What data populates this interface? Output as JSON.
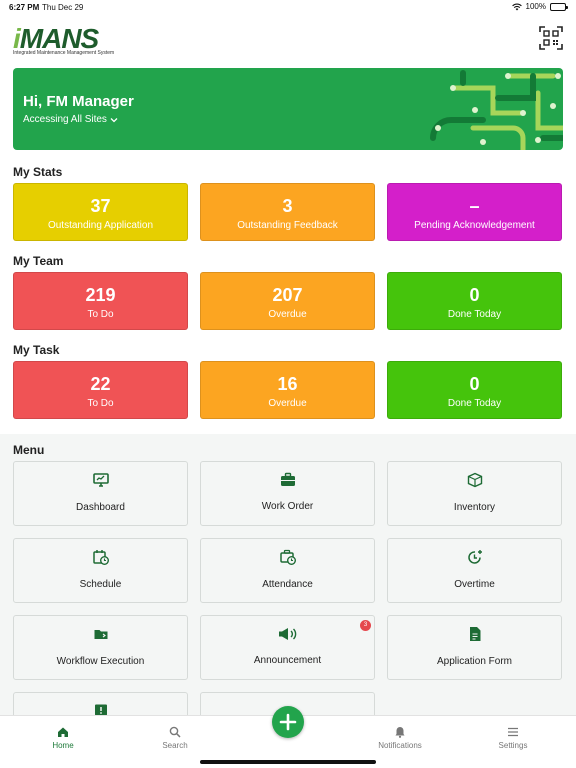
{
  "status_bar": {
    "time": "6:27 PM",
    "date": "Thu Dec 29",
    "battery": "100%"
  },
  "brand": {
    "logo_text": "MANS",
    "logo_i": "i",
    "tagline": "Integrated Maintenance Management System",
    "accent": "#22a44c"
  },
  "hero": {
    "greeting": "Hi, FM Manager",
    "site_selector": "Accessing All Sites"
  },
  "sections": {
    "stats": "My Stats",
    "team": "My Team",
    "task": "My Task",
    "menu": "Menu"
  },
  "stats": [
    {
      "value": "37",
      "label": "Outstanding Application",
      "color": "#e6cf00"
    },
    {
      "value": "3",
      "label": "Outstanding Feedback",
      "color": "#fca521"
    },
    {
      "value": "–",
      "label": "Pending Acknowledgement",
      "color": "#d41fca"
    }
  ],
  "team": [
    {
      "value": "219",
      "label": "To Do",
      "color": "#f05355"
    },
    {
      "value": "207",
      "label": "Overdue",
      "color": "#fca521"
    },
    {
      "value": "0",
      "label": "Done Today",
      "color": "#45c40c"
    }
  ],
  "task": [
    {
      "value": "22",
      "label": "To Do",
      "color": "#f05355"
    },
    {
      "value": "16",
      "label": "Overdue",
      "color": "#fca521"
    },
    {
      "value": "0",
      "label": "Done Today",
      "color": "#45c40c"
    }
  ],
  "menu": [
    {
      "label": "Dashboard",
      "icon": "dashboard-icon"
    },
    {
      "label": "Work Order",
      "icon": "briefcase-icon"
    },
    {
      "label": "Inventory",
      "icon": "box-icon"
    },
    {
      "label": "Schedule",
      "icon": "calendar-clock-icon"
    },
    {
      "label": "Attendance",
      "icon": "briefcase-clock-icon"
    },
    {
      "label": "Overtime",
      "icon": "clock-plus-icon"
    },
    {
      "label": "Workflow Execution",
      "icon": "folder-icon"
    },
    {
      "label": "Announcement",
      "icon": "megaphone-icon",
      "badge": "3"
    },
    {
      "label": "Application Form",
      "icon": "document-icon"
    }
  ],
  "tabs": [
    {
      "label": "Home",
      "icon": "home-icon"
    },
    {
      "label": "Search",
      "icon": "search-icon"
    },
    {
      "label": "Notifications",
      "icon": "bell-icon"
    },
    {
      "label": "Settings",
      "icon": "menu-icon"
    }
  ]
}
